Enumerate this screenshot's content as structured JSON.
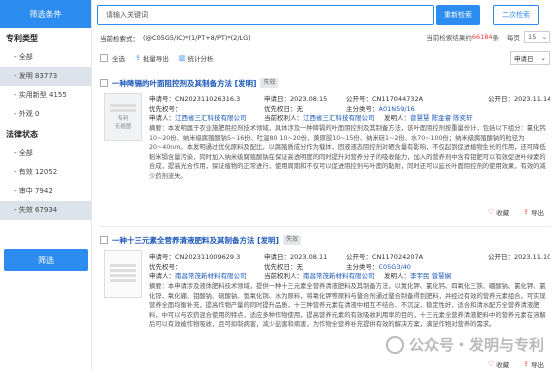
{
  "sidebar": {
    "filter_title": "筛选条件",
    "sections": [
      {
        "title": "专利类型",
        "items": [
          "- 全部",
          "- 发明 83773",
          "- 实用新型 4155",
          "- 外观 0"
        ]
      },
      {
        "title": "法律状态",
        "items": [
          "- 全部",
          "- 有效 12052",
          "- 审中 7942",
          "- 失效 67934"
        ]
      }
    ],
    "filter_button": "筛选"
  },
  "search": {
    "placeholder": "请输入关键词",
    "refresh_label": "重新检索",
    "second_label": "二次检索"
  },
  "query": {
    "label": "当前检索式：",
    "text": "(@C05G5/IC)*(1/PT+8/PT)*(2/LG)",
    "result_prefix": "当前检索结果约",
    "result_count": "66184",
    "result_suffix": "条",
    "per_page_label": "每页",
    "per_page_value": "15"
  },
  "toolbar": {
    "select_all": "全选",
    "batch_export": "批量导出",
    "stats": "统计分析",
    "sort": "申请日"
  },
  "results": [
    {
      "title": "一种降镉的叶面阻控剂及其制备方法 [发明]",
      "status": "失效",
      "thumb_text_1": "专利",
      "thumb_text_2": "无插图",
      "row1": {
        "app_no": "申请号：CN202311026316.3",
        "app_date": "申请日：2023.08.15",
        "pub_no": "公开号：CN117044732A",
        "pub_date": "公开日：2023.11.14"
      },
      "row2": {
        "priority_no": "优先权号：",
        "priority_date": "优先权日：无",
        "ipc_label": "主分类号：",
        "ipc": "A01N59/16"
      },
      "row3": {
        "applicant_label": "申请人：",
        "applicant": "江西省三汇科技有限公司",
        "right_holder_label": "当前权利人：",
        "right_holder": "江西省三汇科技有限公司",
        "inventor_label": "发明人：",
        "inventors": "曾慧慧 陈金睿 陈奕轩"
      },
      "abstract": "摘要：本发明属于农业施肥阻控剂技术领域，具体涉及一种降镉的叶面阻控剂及其制备方法，该叶面阻控剂按重量份计，包括以下组分：氯化钙10~20份、纳米级腐殖酸钠5~16份、吐温80 10~20份、黄原胶10~15份、纳米硅1~2份、水70~100份；纳米级腐殖酸钠的粒径为20~40nm。本发明通过优化原料及配比，以腐殖质成分作为载体，固液液态阻控剂对硒含量有影响，不仅起到促进植物生长的作用，还可降低稻米镉含量污染，同时加入纳米级腐殖酸钠在保证高透明度的同时提升对营养分子的吸收能力，加入的营养剂中含有钼肥可以有效促进叶绿素的合成，提高光合作用，保证植物的正常进行，使用周期和不仅可以促进阻控剂与叶面的黏附，同时还可以延长叶面阻控剂的使用效果，有效的减少药剂流失。",
      "collect": "收藏",
      "export": "导出"
    },
    {
      "title": "一种十三元素全营养清液肥料及其制备方法 [发明]",
      "status": "失效",
      "thumb_text_1": "",
      "thumb_text_2": "",
      "row1": {
        "app_no": "申请号：CN202311009629.3",
        "app_date": "申请日：2023.08.11",
        "pub_no": "公开号：CN117024207A",
        "pub_date": "公开日：2023.11.10"
      },
      "row2": {
        "priority_no": "优先权号：",
        "priority_date": "优先权日：无",
        "ipc_label": "主分类号：",
        "ipc": "C05G3/40"
      },
      "row3": {
        "applicant_label": "申请人：",
        "applicant": "南昌常茂新材料有限公司",
        "right_holder_label": "当前权利人：",
        "right_holder": "南昌常茂新材料有限公司",
        "inventor_label": "发明人：",
        "inventors": "李宇民 曾慧娴"
      },
      "abstract": "摘要：本申请涉及液体肥料技术领域，提供一种十三元素全营养清液肥料及其制备方法，以氮化钾、氯化钙、四氧化三铁、硼酸钠、氯化钾、氯化锌、氧化硼、钼酸钠、硫酸钠、氢氧化铜、水为原料，将氧化钾等原料与螯合剂通过螯合制备得到肥料，并经过有效的营养元素组合，可实现营养全面均衡补充，提高作物产量的同时提升品质，十三种营养元素在清液中相互不结合、不沉淀，稳定性好，适合和清水配方全营养清液肥料，中可以与农药混合使用的特点，适应多种作物使用，提高营养元素的有效吸收利用率的目的，十三元素全营养清液肥料中的营养元素在溶解后可以有效被作物吸收，且可抑制病害，减少盐害和病害，为作物全营养补充提供有效的解决方案，满足作物对营养的需求。",
      "collect": "收藏",
      "export": "导出"
    }
  ],
  "watermark": "公众号・发明与专利",
  "colors": {
    "accent": "#2d8cf0",
    "link": "#1a56b8",
    "count": "#e4393c"
  }
}
